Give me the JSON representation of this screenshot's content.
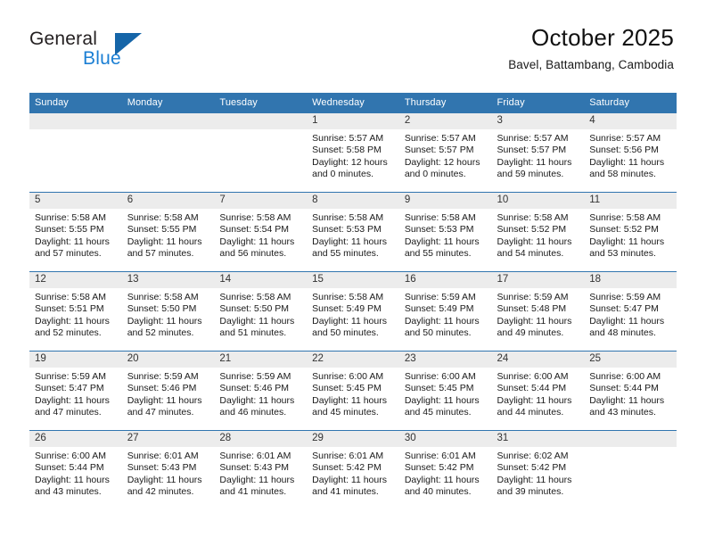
{
  "brand": {
    "name_part1": "General",
    "name_part2": "Blue",
    "logo_icon": "triangle-logo-icon",
    "accent_color": "#1565a8",
    "text_color": "#1b7fd4"
  },
  "header": {
    "title": "October 2025",
    "subtitle": "Bavel, Battambang, Cambodia",
    "header_bg_color": "#3175AF",
    "daynum_bg_color": "#ECECEC"
  },
  "columns": [
    "Sunday",
    "Monday",
    "Tuesday",
    "Wednesday",
    "Thursday",
    "Friday",
    "Saturday"
  ],
  "weeks": [
    [
      {
        "day": "",
        "lines": []
      },
      {
        "day": "",
        "lines": []
      },
      {
        "day": "",
        "lines": []
      },
      {
        "day": "1",
        "lines": [
          "Sunrise: 5:57 AM",
          "Sunset: 5:58 PM",
          "Daylight: 12 hours",
          "and 0 minutes."
        ]
      },
      {
        "day": "2",
        "lines": [
          "Sunrise: 5:57 AM",
          "Sunset: 5:57 PM",
          "Daylight: 12 hours",
          "and 0 minutes."
        ]
      },
      {
        "day": "3",
        "lines": [
          "Sunrise: 5:57 AM",
          "Sunset: 5:57 PM",
          "Daylight: 11 hours",
          "and 59 minutes."
        ]
      },
      {
        "day": "4",
        "lines": [
          "Sunrise: 5:57 AM",
          "Sunset: 5:56 PM",
          "Daylight: 11 hours",
          "and 58 minutes."
        ]
      }
    ],
    [
      {
        "day": "5",
        "lines": [
          "Sunrise: 5:58 AM",
          "Sunset: 5:55 PM",
          "Daylight: 11 hours",
          "and 57 minutes."
        ]
      },
      {
        "day": "6",
        "lines": [
          "Sunrise: 5:58 AM",
          "Sunset: 5:55 PM",
          "Daylight: 11 hours",
          "and 57 minutes."
        ]
      },
      {
        "day": "7",
        "lines": [
          "Sunrise: 5:58 AM",
          "Sunset: 5:54 PM",
          "Daylight: 11 hours",
          "and 56 minutes."
        ]
      },
      {
        "day": "8",
        "lines": [
          "Sunrise: 5:58 AM",
          "Sunset: 5:53 PM",
          "Daylight: 11 hours",
          "and 55 minutes."
        ]
      },
      {
        "day": "9",
        "lines": [
          "Sunrise: 5:58 AM",
          "Sunset: 5:53 PM",
          "Daylight: 11 hours",
          "and 55 minutes."
        ]
      },
      {
        "day": "10",
        "lines": [
          "Sunrise: 5:58 AM",
          "Sunset: 5:52 PM",
          "Daylight: 11 hours",
          "and 54 minutes."
        ]
      },
      {
        "day": "11",
        "lines": [
          "Sunrise: 5:58 AM",
          "Sunset: 5:52 PM",
          "Daylight: 11 hours",
          "and 53 minutes."
        ]
      }
    ],
    [
      {
        "day": "12",
        "lines": [
          "Sunrise: 5:58 AM",
          "Sunset: 5:51 PM",
          "Daylight: 11 hours",
          "and 52 minutes."
        ]
      },
      {
        "day": "13",
        "lines": [
          "Sunrise: 5:58 AM",
          "Sunset: 5:50 PM",
          "Daylight: 11 hours",
          "and 52 minutes."
        ]
      },
      {
        "day": "14",
        "lines": [
          "Sunrise: 5:58 AM",
          "Sunset: 5:50 PM",
          "Daylight: 11 hours",
          "and 51 minutes."
        ]
      },
      {
        "day": "15",
        "lines": [
          "Sunrise: 5:58 AM",
          "Sunset: 5:49 PM",
          "Daylight: 11 hours",
          "and 50 minutes."
        ]
      },
      {
        "day": "16",
        "lines": [
          "Sunrise: 5:59 AM",
          "Sunset: 5:49 PM",
          "Daylight: 11 hours",
          "and 50 minutes."
        ]
      },
      {
        "day": "17",
        "lines": [
          "Sunrise: 5:59 AM",
          "Sunset: 5:48 PM",
          "Daylight: 11 hours",
          "and 49 minutes."
        ]
      },
      {
        "day": "18",
        "lines": [
          "Sunrise: 5:59 AM",
          "Sunset: 5:47 PM",
          "Daylight: 11 hours",
          "and 48 minutes."
        ]
      }
    ],
    [
      {
        "day": "19",
        "lines": [
          "Sunrise: 5:59 AM",
          "Sunset: 5:47 PM",
          "Daylight: 11 hours",
          "and 47 minutes."
        ]
      },
      {
        "day": "20",
        "lines": [
          "Sunrise: 5:59 AM",
          "Sunset: 5:46 PM",
          "Daylight: 11 hours",
          "and 47 minutes."
        ]
      },
      {
        "day": "21",
        "lines": [
          "Sunrise: 5:59 AM",
          "Sunset: 5:46 PM",
          "Daylight: 11 hours",
          "and 46 minutes."
        ]
      },
      {
        "day": "22",
        "lines": [
          "Sunrise: 6:00 AM",
          "Sunset: 5:45 PM",
          "Daylight: 11 hours",
          "and 45 minutes."
        ]
      },
      {
        "day": "23",
        "lines": [
          "Sunrise: 6:00 AM",
          "Sunset: 5:45 PM",
          "Daylight: 11 hours",
          "and 45 minutes."
        ]
      },
      {
        "day": "24",
        "lines": [
          "Sunrise: 6:00 AM",
          "Sunset: 5:44 PM",
          "Daylight: 11 hours",
          "and 44 minutes."
        ]
      },
      {
        "day": "25",
        "lines": [
          "Sunrise: 6:00 AM",
          "Sunset: 5:44 PM",
          "Daylight: 11 hours",
          "and 43 minutes."
        ]
      }
    ],
    [
      {
        "day": "26",
        "lines": [
          "Sunrise: 6:00 AM",
          "Sunset: 5:44 PM",
          "Daylight: 11 hours",
          "and 43 minutes."
        ]
      },
      {
        "day": "27",
        "lines": [
          "Sunrise: 6:01 AM",
          "Sunset: 5:43 PM",
          "Daylight: 11 hours",
          "and 42 minutes."
        ]
      },
      {
        "day": "28",
        "lines": [
          "Sunrise: 6:01 AM",
          "Sunset: 5:43 PM",
          "Daylight: 11 hours",
          "and 41 minutes."
        ]
      },
      {
        "day": "29",
        "lines": [
          "Sunrise: 6:01 AM",
          "Sunset: 5:42 PM",
          "Daylight: 11 hours",
          "and 41 minutes."
        ]
      },
      {
        "day": "30",
        "lines": [
          "Sunrise: 6:01 AM",
          "Sunset: 5:42 PM",
          "Daylight: 11 hours",
          "and 40 minutes."
        ]
      },
      {
        "day": "31",
        "lines": [
          "Sunrise: 6:02 AM",
          "Sunset: 5:42 PM",
          "Daylight: 11 hours",
          "and 39 minutes."
        ]
      },
      {
        "day": "",
        "lines": []
      }
    ]
  ]
}
